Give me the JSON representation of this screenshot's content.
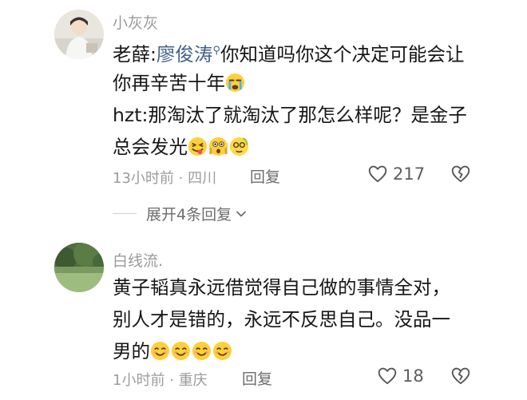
{
  "comments": [
    {
      "username": "小灰灰",
      "line1_prefix": "老薛:",
      "line1_mention": "廖俊涛",
      "line1_rest": "你知道吗你这个决定可能会让",
      "line2": "你再辛苦十年",
      "line3": "hzt:那淘汰了就淘汰了那怎么样呢？是金子",
      "line4": "总会发光",
      "time": "13小时前",
      "separator": "·",
      "location": "四川",
      "reply_label": "回复",
      "like_count": "217",
      "expand_label": "展开4条回复"
    },
    {
      "username": "白线流.",
      "line1": "黄子韬真永远借觉得自己做的事情全对，",
      "line2": "别人才是错的，永远不反思自己。没品一",
      "line3": "男的",
      "time": "1小时前",
      "separator": "·",
      "location": "重庆",
      "reply_label": "回复",
      "like_count": "18"
    }
  ],
  "icons": {
    "mention_search": "search-icon",
    "like": "heart-icon",
    "dislike": "broken-heart-icon",
    "expand": "chevron-down-icon"
  },
  "colors": {
    "mention": "#44608a",
    "username": "#9a9a9a",
    "text": "#161616",
    "meta": "#9c9c9c"
  }
}
